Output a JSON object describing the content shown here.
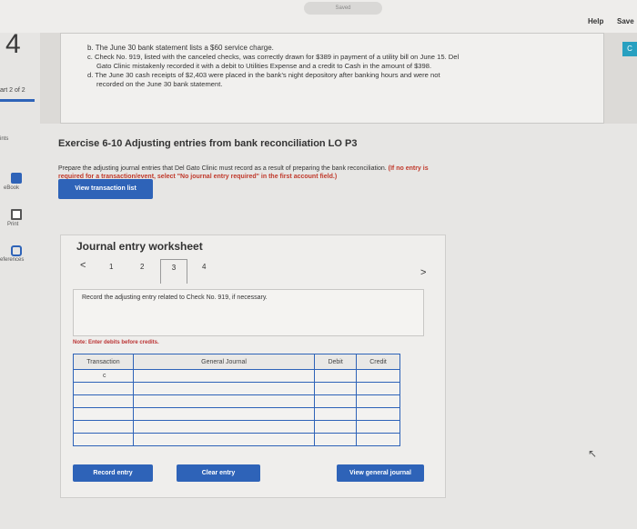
{
  "topbar": {
    "saved": "Saved",
    "help": "Help",
    "save": "Save"
  },
  "sidebar": {
    "question_number": "4",
    "part": "art 2 of 2",
    "points": "ints",
    "ebook": "eBook",
    "print": "Print",
    "references": "eferences"
  },
  "scenario": {
    "b": "b. The June 30 bank statement lists a $60 service charge.",
    "c1": "c. Check No. 919, listed with the canceled checks, was correctly drawn for $389 in payment of a utility bill on June 15. Del",
    "c2": "Gato Clinic mistakenly recorded it with a debit to Utilities Expense and a credit to Cash in the amount of $398.",
    "d1": "d. The June 30 cash receipts of $2,403 were placed in the bank's night depository after banking hours and were not",
    "d2": "recorded on the June 30 bank statement."
  },
  "exercise": {
    "title": "Exercise 6-10 Adjusting entries from bank reconciliation LO P3",
    "instruction1": "Prepare the adjusting journal entries that Del Gato Clinic must record as a result of preparing the bank reconciliation.",
    "instruction1_red": "(If no entry is",
    "instruction2_red": "required for a transaction/event, select \"No journal entry required\" in the first account field.)",
    "view_transaction_list": "View transaction list"
  },
  "worksheet": {
    "title": "Journal entry worksheet",
    "prev": "<",
    "next": ">",
    "pages": [
      "1",
      "2",
      "3",
      "4"
    ],
    "active_page": "3",
    "record_text": "Record the adjusting entry related to Check No. 919, if necessary.",
    "note": "Note: Enter debits before credits.",
    "headers": {
      "transaction": "Transaction",
      "journal": "General Journal",
      "debit": "Debit",
      "credit": "Credit"
    },
    "rows": [
      {
        "transaction": "c"
      },
      {
        "transaction": ""
      },
      {
        "transaction": ""
      },
      {
        "transaction": ""
      },
      {
        "transaction": ""
      },
      {
        "transaction": ""
      }
    ],
    "record_entry": "Record entry",
    "clear_entry": "Clear entry",
    "view_general_journal": "View general journal"
  }
}
